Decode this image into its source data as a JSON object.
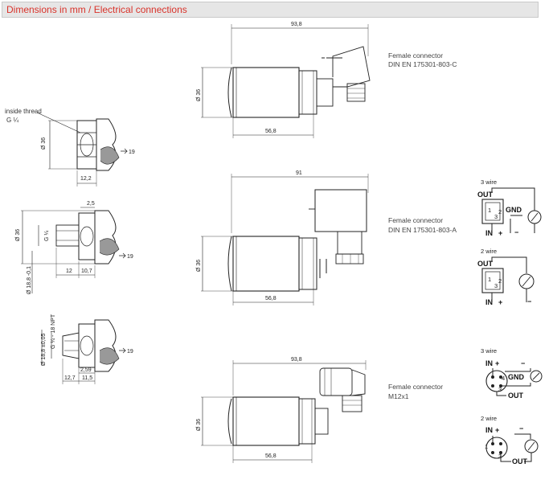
{
  "header": {
    "title": "Dimensions in mm / Electrical connections"
  },
  "fittings": {
    "thread_label_line1": "inside thread",
    "thread_label_line2": "G ¼",
    "f1": {
      "dia": "Ø 36",
      "width": "12,2",
      "wrench": "19"
    },
    "f2": {
      "dim_top": "2,5",
      "dia": "Ø 36",
      "thread": "G ¼",
      "dim_a": "12",
      "dim_b": "10,7",
      "dia_small": "Ø 18,8 -0,1",
      "wrench": "19"
    },
    "f3": {
      "thread": "G ¼ - 18 NPT",
      "dia_small": "Ø 18,8 ±0,05",
      "dim_a": "2,59",
      "dim_b": "12,7",
      "dim_c": "11,5",
      "wrench": "19"
    }
  },
  "sensors": {
    "s1": {
      "length": "93,8",
      "body": "56,8",
      "dia": "Ø 36",
      "connector_line1": "Female connector",
      "connector_line2": "DIN EN 175301-803-C"
    },
    "s2": {
      "length": "91",
      "body": "56,8",
      "dia": "Ø 36",
      "connector_line1": "Female connector",
      "connector_line2": "DIN EN 175301-803-A"
    },
    "s3": {
      "length": "93,8",
      "body": "56,8",
      "dia": "Ø 36",
      "connector_line1": "Female connector",
      "connector_line2": "M12x1"
    }
  },
  "wiring": {
    "w1": {
      "title": "3 wire",
      "out": "OUT",
      "in": "IN",
      "plus": "+",
      "minus": "−",
      "gnd": "GND",
      "pin1": "1",
      "pin2": "2",
      "pin3": "3"
    },
    "w2": {
      "title": "2 wire",
      "out": "OUT",
      "in": "IN",
      "plus": "+",
      "minus": "−",
      "pin1": "1",
      "pin2": "2",
      "pin3": "3"
    },
    "w3": {
      "title": "3 wire",
      "in": "IN",
      "plus": "+",
      "minus": "−",
      "gnd": "GND",
      "out": "OUT",
      "pin1": "1",
      "pin3": "3",
      "pin4": "4"
    },
    "w4": {
      "title": "2 wire",
      "in": "IN",
      "plus": "+",
      "minus": "−",
      "out": "OUT",
      "pin1": "1",
      "pin3": "3"
    }
  }
}
